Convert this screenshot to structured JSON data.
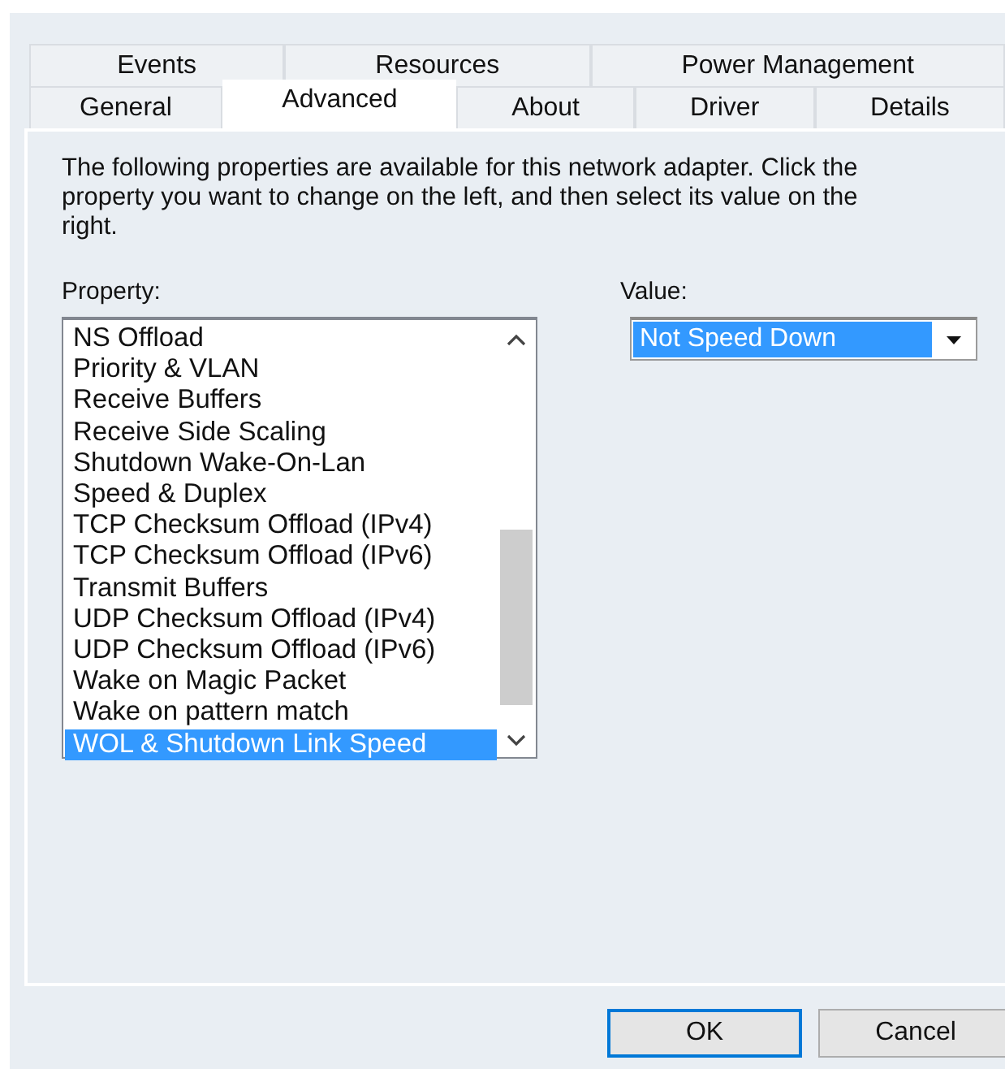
{
  "back_tabs": [
    {
      "label": "Events",
      "selected": false
    },
    {
      "label": "Resources",
      "selected": false
    },
    {
      "label": "Power Management",
      "selected": false
    }
  ],
  "front_tabs": [
    {
      "label": "General",
      "selected": false
    },
    {
      "label": "Advanced",
      "selected": true
    },
    {
      "label": "About",
      "selected": false
    },
    {
      "label": "Driver",
      "selected": false
    },
    {
      "label": "Details",
      "selected": false
    }
  ],
  "description": "The following properties are available for this network adapter. Click the property you want to change on the left, and then select its value on the right.",
  "property": {
    "label": "Property:",
    "items": [
      {
        "label": "NS Offload",
        "selected": false
      },
      {
        "label": "Priority & VLAN",
        "selected": false
      },
      {
        "label": "Receive Buffers",
        "selected": false
      },
      {
        "label": "Receive Side Scaling",
        "selected": false
      },
      {
        "label": "Shutdown Wake-On-Lan",
        "selected": false
      },
      {
        "label": "Speed & Duplex",
        "selected": false
      },
      {
        "label": "TCP Checksum Offload (IPv4)",
        "selected": false
      },
      {
        "label": "TCP Checksum Offload (IPv6)",
        "selected": false
      },
      {
        "label": "Transmit Buffers",
        "selected": false
      },
      {
        "label": "UDP Checksum Offload (IPv4)",
        "selected": false
      },
      {
        "label": "UDP Checksum Offload (IPv6)",
        "selected": false
      },
      {
        "label": "Wake on Magic Packet",
        "selected": false
      },
      {
        "label": "Wake on pattern match",
        "selected": false
      },
      {
        "label": "WOL & Shutdown Link Speed",
        "selected": true
      }
    ]
  },
  "value": {
    "label": "Value:",
    "selected_value": "Not Speed Down"
  },
  "buttons": [
    {
      "label": "OK",
      "focused": true
    },
    {
      "label": "Cancel",
      "focused": false
    }
  ]
}
